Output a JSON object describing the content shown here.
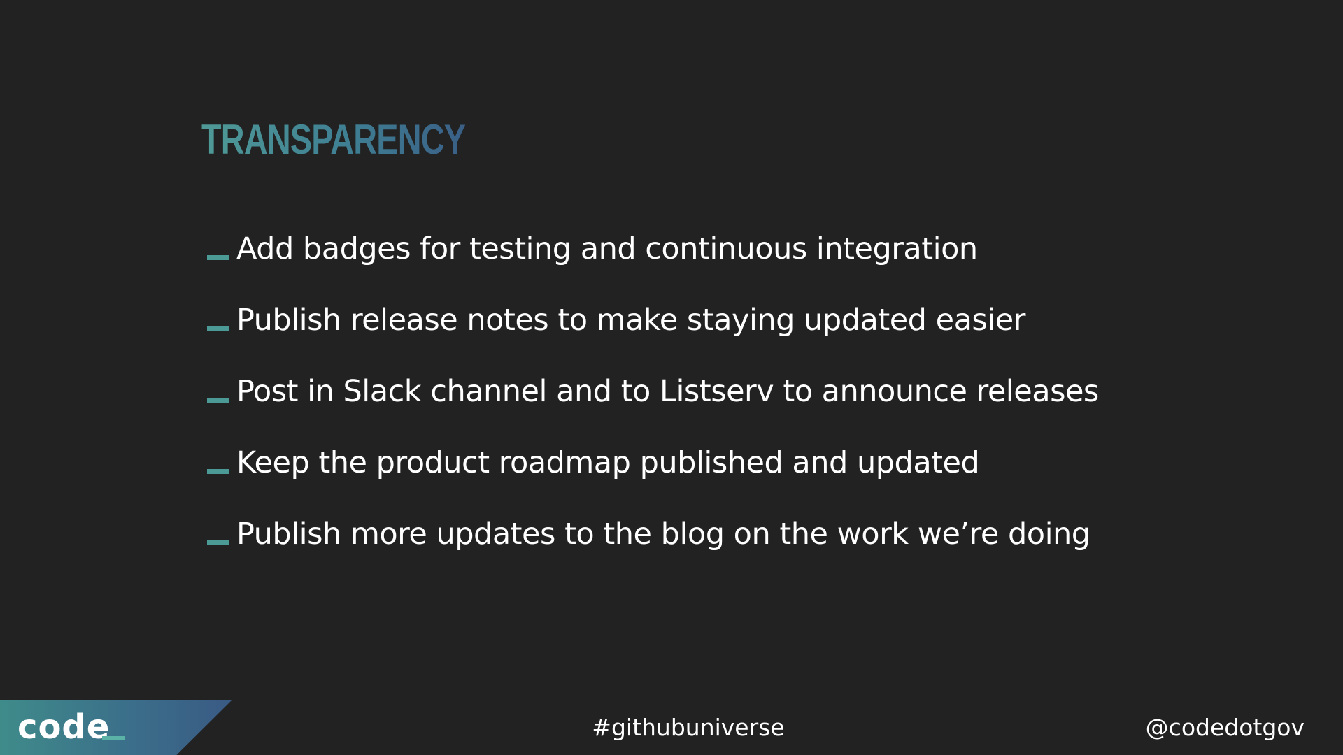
{
  "slide": {
    "title": "TRANSPARENCY",
    "bullets": [
      "Add badges for testing and continuous integration",
      "Publish release notes to make staying updated easier",
      "Post in Slack channel and to Listserv to announce releases",
      "Keep the product roadmap published and updated",
      "Publish more updates to the blog on the work we’re doing"
    ]
  },
  "footer": {
    "logo": "code",
    "hashtag": "#githubuniverse",
    "handle": "@codedotgov"
  },
  "colors": {
    "background": "#222222",
    "accent": "#4c9a96",
    "title_gradient_start": "#4f9a97",
    "title_gradient_end": "#3a5f86"
  }
}
